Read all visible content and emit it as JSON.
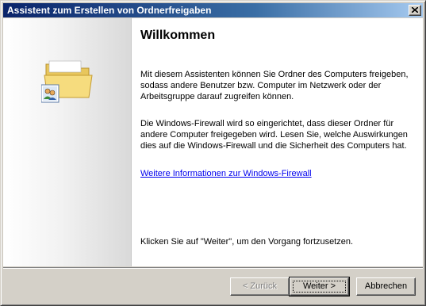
{
  "window": {
    "title": "Assistent zum Erstellen von Ordnerfreigaben",
    "close_icon": "close-icon"
  },
  "sidebar": {
    "icon": "shared-folder-icon"
  },
  "main": {
    "heading": "Willkommen",
    "paragraph1": "Mit diesem Assistenten können Sie Ordner des Computers freigeben, sodass andere Benutzer bzw. Computer im Netzwerk oder der Arbeitsgruppe darauf zugreifen können.",
    "paragraph2": "Die Windows-Firewall wird so eingerichtet, dass dieser Ordner für andere Computer freigegeben wird. Lesen Sie, welche Auswirkungen dies auf die Windows-Firewall und die Sicherheit des Computers hat.",
    "link": "Weitere Informationen zur Windows-Firewall",
    "instruction": "Klicken Sie auf \"Weiter\", um den Vorgang fortzusetzen."
  },
  "buttons": {
    "back": "< Zurück",
    "next": "Weiter >",
    "cancel": "Abbrechen"
  },
  "colors": {
    "title_gradient_start": "#0a246a",
    "title_gradient_end": "#a6caf0",
    "link": "#0000ee",
    "dialog_face": "#d4d0c8"
  }
}
